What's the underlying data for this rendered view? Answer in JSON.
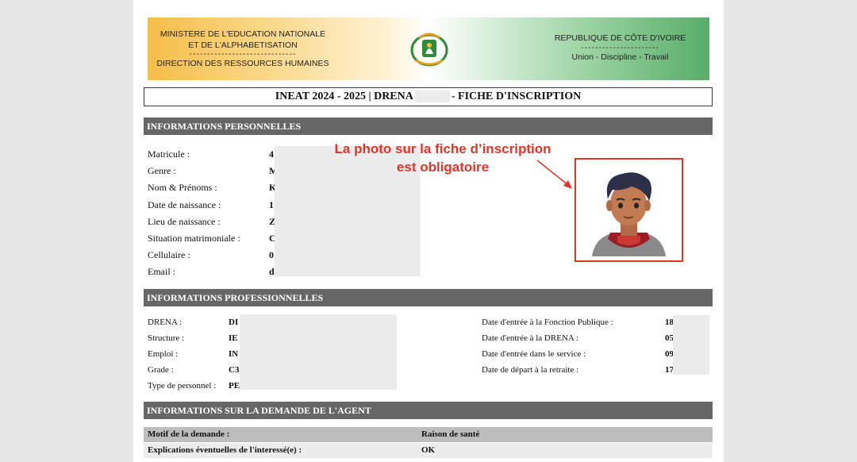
{
  "header": {
    "left_line1": "MINISTERE DE L'EDUCATION NATIONALE",
    "left_line2": "ET DE L'ALPHABETISATION",
    "left_dashes": "------------------------------",
    "left_line3": "DIRECTION DES RESSOURCES HUMAINES",
    "right_line1": "REPUBLIQUE DE CÔTE D'IVOIRE",
    "right_dashes": "----------------------",
    "right_line2": "Union - Discipline - Travail",
    "emblem_icon": "coat-of-arms-icon"
  },
  "title": {
    "part1": "INEAT 2024 - 2025 | DRENA",
    "part2": "- FICHE D'INSCRIPTION"
  },
  "sections": {
    "personal": "INFORMATIONS PERSONNELLES",
    "professional": "INFORMATIONS PROFESSIONNELLES",
    "request": "INFORMATIONS SUR LA DEMANDE DE L'AGENT"
  },
  "personal": [
    {
      "label": "Matricule :",
      "value": "4"
    },
    {
      "label": "Genre :",
      "value": "M"
    },
    {
      "label": "Nom & Prénoms :",
      "value": "K"
    },
    {
      "label": "Date de naissance :",
      "value": "1"
    },
    {
      "label": "Lieu de naissance :",
      "value": "Z"
    },
    {
      "label": "Situation matrimoniale :",
      "value": "C"
    },
    {
      "label": "Cellulaire :",
      "value": "0"
    },
    {
      "label": "Email :",
      "value": "d"
    }
  ],
  "annotation": {
    "line1": "La photo sur la fiche d’inscription",
    "line2": "est obligatoire"
  },
  "photo": {
    "icon": "avatar-photo-icon",
    "border_color": "#e0362a"
  },
  "professional_left": [
    {
      "label": "DRENA :",
      "value": "DI"
    },
    {
      "label": "Structure :",
      "value": "IE"
    },
    {
      "label": "Emploi :",
      "value": "IN"
    },
    {
      "label": "Grade :",
      "value": "C3"
    },
    {
      "label": "Type de personnel :",
      "value": "PE"
    }
  ],
  "professional_right": [
    {
      "label": "Date d'entrée à la Fonction Publique :",
      "value": "18"
    },
    {
      "label": "Date d'entrée à la DRENA :",
      "value": "05"
    },
    {
      "label": "Date d'entrée dans le service :",
      "value": "09"
    },
    {
      "label": "Date de départ à la retraite :",
      "value": "17"
    }
  ],
  "request": [
    {
      "label": "Motif de la demande :",
      "value": "Raison de santé"
    },
    {
      "label": "Explications éventuelles de l'interessé(e) :",
      "value": "OK"
    }
  ],
  "colors": {
    "section_bg": "#666666",
    "accent_red": "#e0362a",
    "row_shaded": "#bdbdbd",
    "row_light": "#ececec"
  }
}
